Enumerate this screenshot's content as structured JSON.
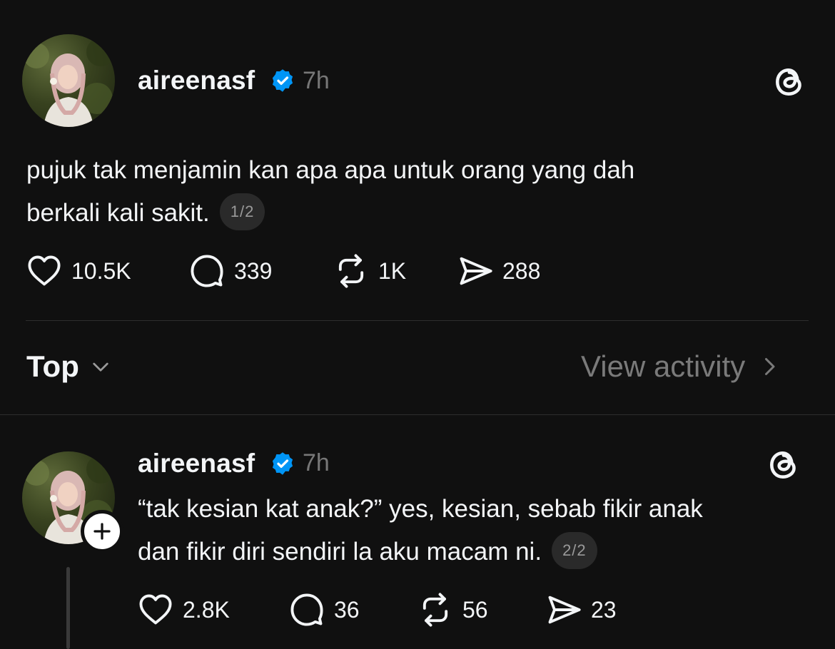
{
  "post": {
    "username": "aireenasf",
    "time": "7h",
    "text_line1": "pujuk tak menjamin kan apa apa untuk orang yang dah",
    "text_line2": "berkali kali sakit.",
    "pager": "1/2",
    "likes": "10.5K",
    "replies": "339",
    "reposts": "1K",
    "shares": "288"
  },
  "filter": {
    "sort_label": "Top",
    "view_activity": "View activity"
  },
  "reply": {
    "username": "aireenasf",
    "time": "7h",
    "text_line1": "“tak kesian kat anak?” yes, kesian, sebab fikir anak",
    "text_line2": "dan fikir diri sendiri la aku macam ni.",
    "pager": "2/2",
    "likes": "2.8K",
    "replies": "36",
    "reposts": "56",
    "shares": "23"
  },
  "colors": {
    "background": "#101010",
    "verified": "#0095f6",
    "muted": "#777777"
  },
  "icons": [
    "verified-badge-icon",
    "threads-logo-icon",
    "heart-icon",
    "comment-icon",
    "repost-icon",
    "share-icon",
    "chevron-down-icon",
    "chevron-right-icon",
    "plus-icon"
  ]
}
